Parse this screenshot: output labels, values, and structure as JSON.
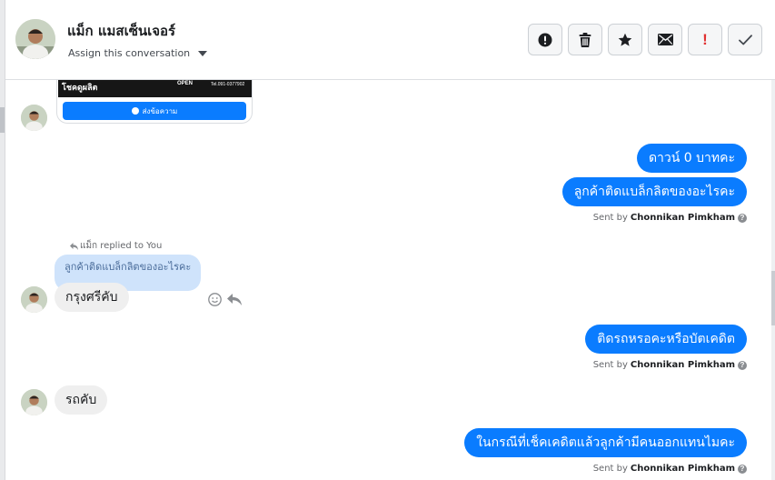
{
  "header": {
    "contact_name": "แม็ก แมสเซ็นเจอร์",
    "assign_label": "Assign this conversation",
    "actions": [
      {
        "name": "mark-spam-button",
        "icon": "alert-circle-icon"
      },
      {
        "name": "delete-button",
        "icon": "trash-icon"
      },
      {
        "name": "star-button",
        "icon": "star-icon"
      },
      {
        "name": "mark-unread-button",
        "icon": "envelope-icon"
      },
      {
        "name": "follow-up-button",
        "icon": "exclamation-icon",
        "glyph": "!"
      },
      {
        "name": "mark-done-button",
        "icon": "checkmark-icon"
      }
    ]
  },
  "card": {
    "brand": "โชคดูผลิต",
    "open_label": "OPEN",
    "tel": "Tel.091-0377902",
    "button_label": "ส่งข้อความ"
  },
  "messages": [
    {
      "dir": "out",
      "text": "ดาวน์ 0 บาทคะ"
    },
    {
      "dir": "out",
      "text": "ลูกค้าติดแบล็กลิตของอะไรคะ"
    },
    {
      "dir": "in",
      "reply_hint": "แม็ก replied to You",
      "quoted": "ลูกค้าติดแบล็กลิตของอะไรคะ",
      "text": "กรุงศรีคับ"
    },
    {
      "dir": "out",
      "text": "ติดรถหรอคะหรือบัตเคดิต"
    },
    {
      "dir": "in",
      "text": "รถคับ"
    },
    {
      "dir": "out",
      "text": "ในกรณีที่เช็คเคดิตแล้วลูกค้ามีคนออกแทนไมคะ"
    }
  ],
  "sent_by": {
    "prefix": "Sent by",
    "agent": "Chonnikan Pimkham"
  },
  "colors": {
    "outgoing_bubble": "#0a7cff",
    "incoming_bubble": "#efefef",
    "quoted_bubble": "#cfe3fb",
    "follow_up_accent": "#e03131"
  }
}
